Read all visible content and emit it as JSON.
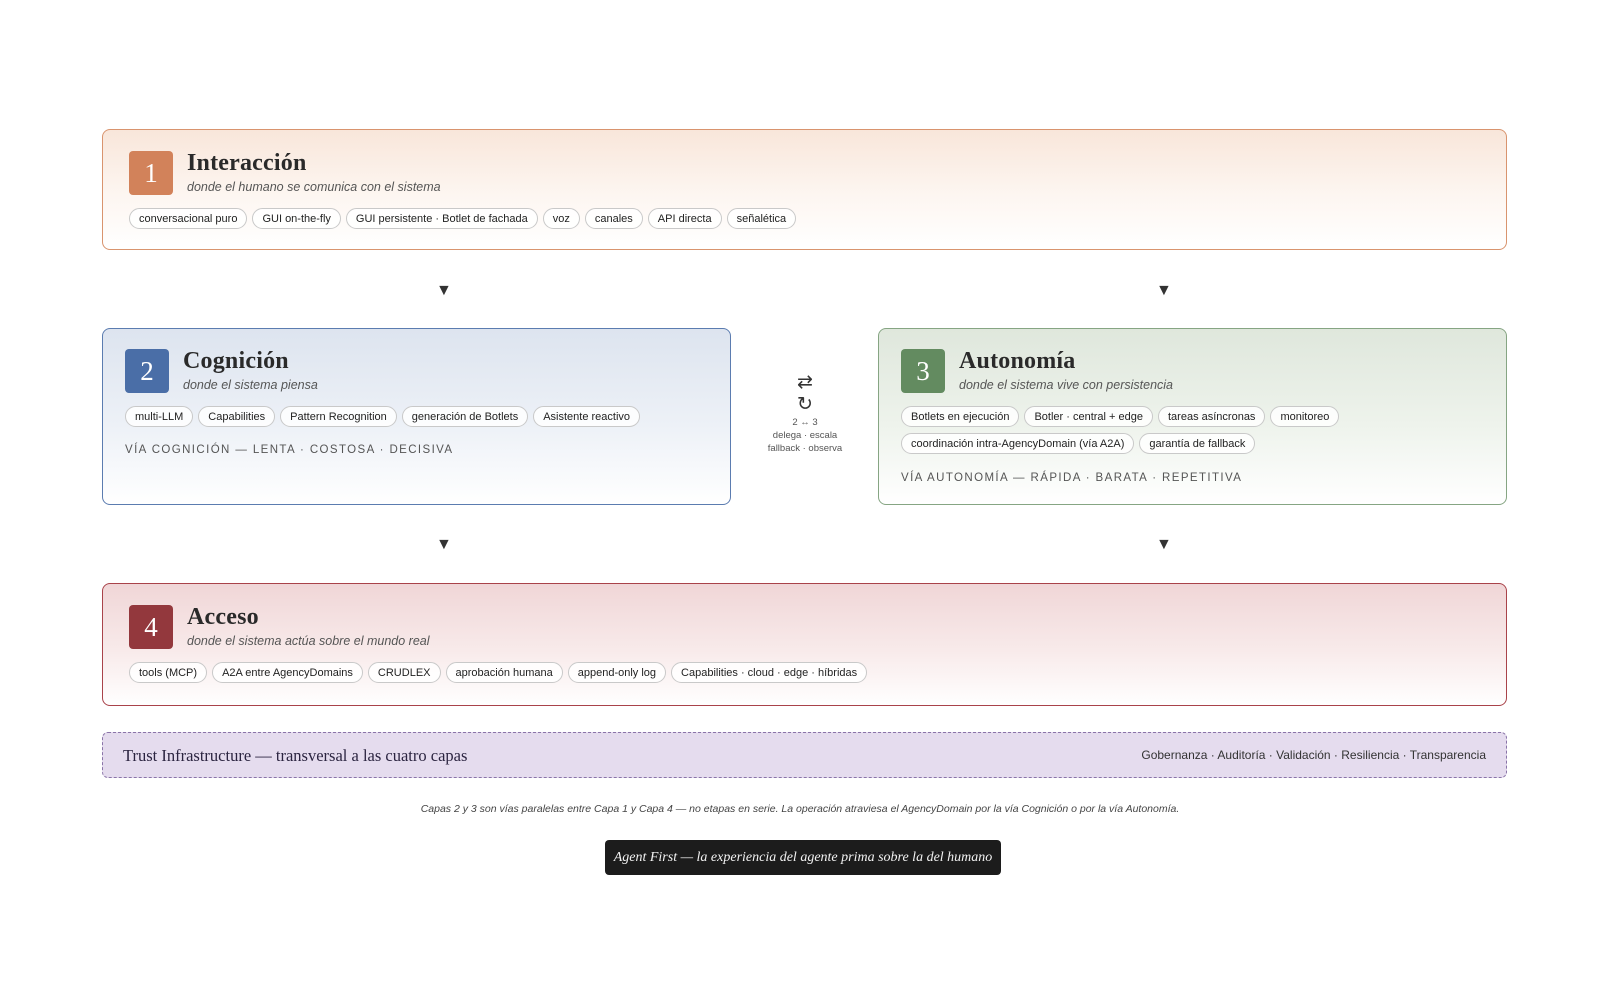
{
  "layers": [
    {
      "number": "1",
      "title": "Interacción",
      "subtitle": "donde el humano se comunica con el sistema",
      "chips": [
        "conversacional puro",
        "GUI on-the-fly",
        "GUI persistente · Botlet de fachada",
        "voz",
        "canales",
        "API directa",
        "señalética"
      ],
      "accent": "#d2825a"
    },
    {
      "number": "2",
      "title": "Cognición",
      "subtitle": "donde el sistema piensa",
      "chips": [
        "multi-LLM",
        "Capabilities",
        "Pattern Recognition",
        "generación de Botlets",
        "Asistente reactivo"
      ],
      "via": "VÍA COGNICIÓN — LENTA · COSTOSA · DECISIVA",
      "accent": "#4a6ea7"
    },
    {
      "number": "3",
      "title": "Autonomía",
      "subtitle": "donde el sistema vive con persistencia",
      "chips": [
        "Botlets en ejecución",
        "Botler · central + edge",
        "tareas asíncronas",
        "monitoreo",
        "coordinación intra-AgencyDomain (vía A2A)",
        "garantía de fallback"
      ],
      "via": "VÍA AUTONOMÍA — RÁPIDA · BARATA · REPETITIVA",
      "accent": "#638b60"
    },
    {
      "number": "4",
      "title": "Acceso",
      "subtitle": "donde el sistema actúa sobre el mundo real",
      "chips": [
        "tools (MCP)",
        "A2A entre AgencyDomains",
        "CRUDLEX",
        "aprobación humana",
        "append-only log",
        "Capabilities · cloud · edge · híbridas"
      ],
      "accent": "#93383d"
    }
  ],
  "connector": {
    "arrow_glyph": "▼",
    "swap_icon": "⇄",
    "cycle_icon": "↻",
    "line1": "2 ↔ 3",
    "line2": "delega · escala",
    "line3": "fallback · observa"
  },
  "trust": {
    "title": "Trust Infrastructure — transversal a las cuatro capas",
    "pillars": "Gobernanza · Auditoría · Validación · Resiliencia · Transparencia",
    "accent": "#8a74a8"
  },
  "note": "Capas 2 y 3 son vías paralelas entre Capa 1 y Capa 4 — no etapas en serie. La operación atraviesa el AgencyDomain por la vía Cognición o por la vía Autonomía.",
  "motto": "Agent First — la experiencia del agente prima sobre la del humano"
}
